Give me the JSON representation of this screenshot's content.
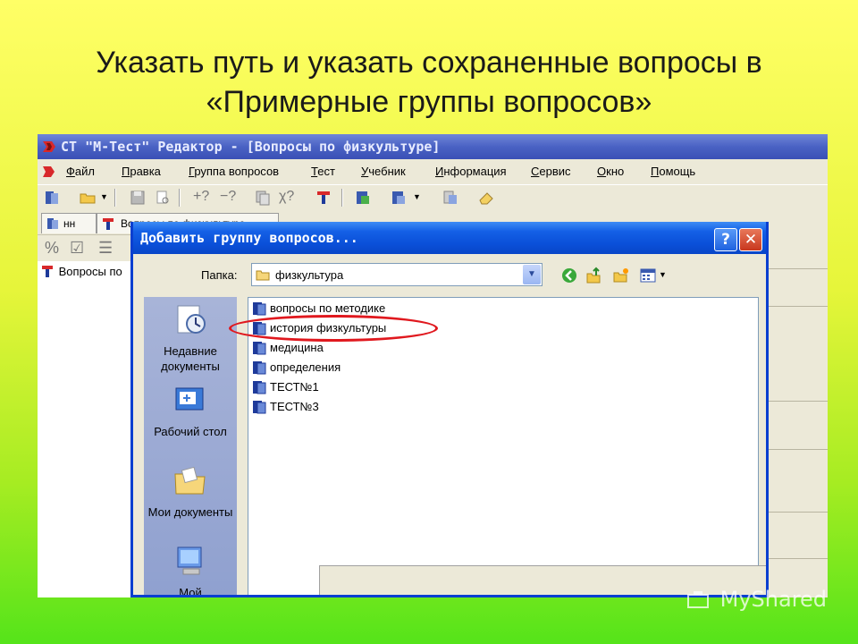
{
  "slide": {
    "title_line1": "Указать путь и указать сохраненные вопросы  в",
    "title_line2": "«Примерные группы вопросов»"
  },
  "app": {
    "title": "СТ \"М-Тест\" Редактор - [Вопросы по физкультуре]",
    "menu": [
      {
        "u": "Ф",
        "rest": "айл"
      },
      {
        "u": "П",
        "rest": "равка"
      },
      {
        "u": "Г",
        "rest": "руппа вопросов"
      },
      {
        "u": "Т",
        "rest": "ест"
      },
      {
        "u": "У",
        "rest": "чебник"
      },
      {
        "u": "И",
        "rest": "нформация"
      },
      {
        "u": "С",
        "rest": "ервис"
      },
      {
        "u": "О",
        "rest": "кно"
      },
      {
        "u": "П",
        "rest": "омощь"
      }
    ],
    "tabs": [
      "нн",
      "Вопросы по физкультуре"
    ],
    "tree_item": "Вопросы по"
  },
  "dialog": {
    "title": "Добавить группу вопросов...",
    "help_label": "?",
    "close_label": "✕",
    "folder_label": "Папка:",
    "folder_value": "физкультура",
    "places": [
      "Недавние документы",
      "Рабочий стол",
      "Мои документы",
      "Мой"
    ],
    "files": [
      "вопросы по методике",
      "история физкультуры",
      "медицина",
      "определения",
      "ТЕСТ№1",
      "ТЕСТ№3"
    ]
  },
  "watermark": "MyShared",
  "colors": {
    "xp_blue": "#0a4fd8",
    "highlight_ellipse": "#e0181e"
  }
}
